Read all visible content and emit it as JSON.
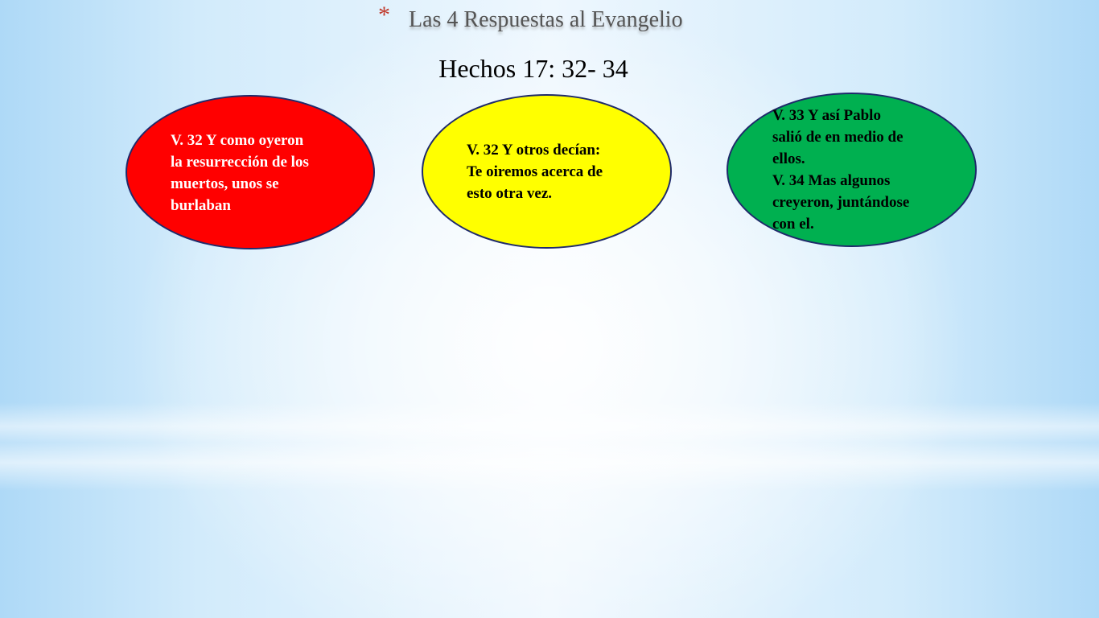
{
  "slide": {
    "title": "Las 4 Respuestas al Evangelio",
    "bullet_glyph": "*",
    "subtitle": "Hechos 17: 32- 34"
  },
  "responses": [
    {
      "text": "V. 32 Y como oyeron\nla resurrección de los\nmuertos, unos se\nburlaban",
      "fill": "#ff0000",
      "text_color": "#ffffff"
    },
    {
      "text": "V. 32 Y otros decían:\nTe oiremos acerca de\nesto otra vez.",
      "fill": "#ffff00",
      "text_color": "#000000"
    },
    {
      "text": "   V. 33 Y así Pablo\nsalió de en medio de\nellos.\nV. 34 Mas algunos\ncreyeron, juntándose\ncon el.",
      "fill": "#00b050",
      "text_color": "#000000"
    }
  ],
  "colors": {
    "outline": "#1f2a6b",
    "title_text": "#555555",
    "bullet": "#c0392b"
  }
}
